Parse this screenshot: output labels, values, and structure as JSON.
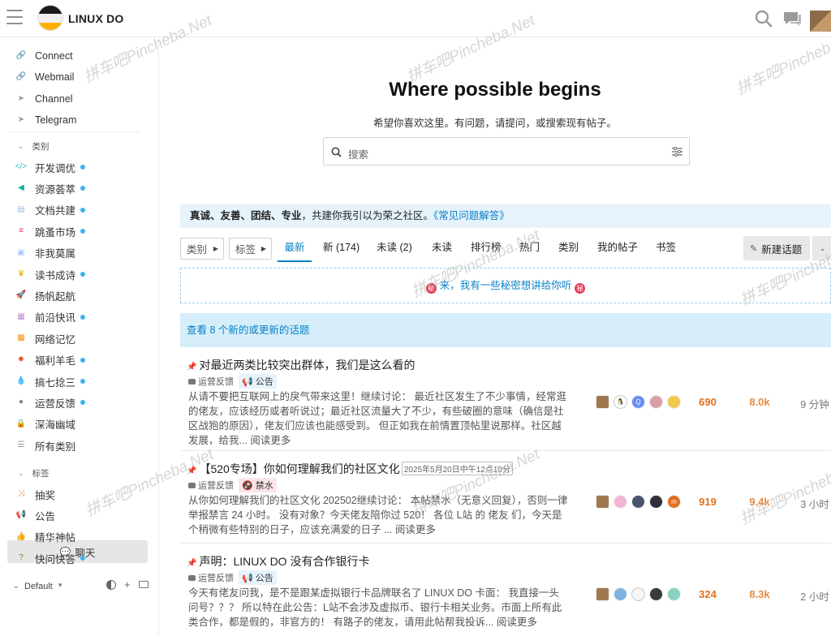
{
  "header": {
    "site_title": "LINUX DO"
  },
  "sidebar": {
    "links": [
      {
        "label": "Connect",
        "icon": "link-icon"
      },
      {
        "label": "Webmail",
        "icon": "link-icon"
      },
      {
        "label": "Channel",
        "icon": "send-icon"
      },
      {
        "label": "Telegram",
        "icon": "send-icon"
      }
    ],
    "categories_header": "类别",
    "categories": [
      {
        "label": "开发调优",
        "icon": "code-icon",
        "color": "#32c3c3",
        "dot": true
      },
      {
        "label": "资源荟萃",
        "icon": "share-icon",
        "color": "#12a89d",
        "dot": true
      },
      {
        "label": "文档共建",
        "icon": "doc-icon",
        "color": "#9cc2e6",
        "dot": true
      },
      {
        "label": "跳蚤市场",
        "icon": "stack-icon",
        "color": "#ed207b",
        "dot": true
      },
      {
        "label": "非我莫属",
        "icon": "briefcase-icon",
        "color": "#a8c6fe",
        "dot": false
      },
      {
        "label": "读书成诗",
        "icon": "crown-icon",
        "color": "#e0b100",
        "dot": true
      },
      {
        "label": "扬帆起航",
        "icon": "rocket-icon",
        "color": "#ff9838",
        "dot": false
      },
      {
        "label": "前沿快讯",
        "icon": "news-icon",
        "color": "#bb8fce",
        "dot": true
      },
      {
        "label": "网络记忆",
        "icon": "memory-icon",
        "color": "#f7941d",
        "dot": false
      },
      {
        "label": "福利羊毛",
        "icon": "gift-icon",
        "color": "#e45735",
        "dot": true
      },
      {
        "label": "搞七捻三",
        "icon": "drop-icon",
        "color": "#3ab54a",
        "dot": true
      },
      {
        "label": "运营反馈",
        "icon": "chat-icon",
        "color": "#808281",
        "dot": true
      },
      {
        "label": "深海幽域",
        "icon": "lock-icon",
        "color": "#45b7d1",
        "dot": false
      },
      {
        "label": "所有类别",
        "icon": "list-icon",
        "color": "#999999",
        "dot": false
      }
    ],
    "tags_header": "标签",
    "tags": [
      {
        "label": "抽奖",
        "icon": "shuffle-icon",
        "color": "#f07d22",
        "dot": false
      },
      {
        "label": "公告",
        "icon": "megaphone-icon",
        "color": "#1e88e5",
        "dot": false
      },
      {
        "label": "精华神帖",
        "icon": "thumbs-up-icon",
        "color": "#1e88e5",
        "dot": false
      },
      {
        "label": "快问快答",
        "icon": "question-icon",
        "color": "#5b8c2a",
        "dot": true
      }
    ],
    "chat_button": "聊天",
    "footer_theme": "Default"
  },
  "hero": {
    "title": "Where possible begins",
    "subtitle": "希望你喜欢这里。有问题，请提问，或搜索现有帖子。",
    "search_placeholder": "搜索"
  },
  "banner": {
    "values": "真诚、友善、团结、专业",
    "rest": "，共建你我引以为荣之社区。",
    "link": "《常见问题解答》"
  },
  "nav": {
    "category_dropdown": "类别",
    "tag_dropdown": "标签",
    "tabs": [
      "最新",
      "新 (174)",
      "未读 (2)",
      "未读",
      "排行榜",
      "热门",
      "类别",
      "我的帖子",
      "书签"
    ],
    "new_topic": "新建话题"
  },
  "hint": "来，我有一些秘密想讲给你听",
  "new_topics_notice": "查看 8 个新的或更新的话题",
  "topics": [
    {
      "title": "对最近两类比较突出群体，我们是这么看的",
      "date": "",
      "category": "运营反馈",
      "tag": "公告",
      "tag_icon": "megaphone-icon",
      "excerpt": "从请不要把互联网上的戾气带来这里！继续讨论：  最近社区发生了不少事情，经常逛的佬友，应该经历或者听说过；最近社区流量大了不少，有些破圈的意味（确信是社区战狍的原因），佬友们应该也能感受到。 但正如我在前情置顶帖里说那样。社区越发展，给我...",
      "read_more": "阅读更多",
      "replies": "690",
      "views": "8.0k",
      "activity": "9 分钟"
    },
    {
      "title": "【520专场】你如何理解我们的社区文化",
      "date": "2025年5月20日中午12点10分",
      "category": "运营反馈",
      "tag": "禁水",
      "tag_icon": "no-water-icon",
      "excerpt": "从你如何理解我们的社区文化 202502继续讨论：  本帖禁水（无意义回复），否则一律举报禁言 24 小时。 没有对象？今天佬友陪你过 520！ 各位 L站 的 佬友 们，今天是个稍微有些特别的日子，应该充满爱的日子 ...",
      "read_more": "阅读更多",
      "replies": "919",
      "views": "9.4k",
      "activity": "3 小时"
    },
    {
      "title": "声明：LINUX DO 没有合作银行卡",
      "date": "",
      "category": "运营反馈",
      "tag": "公告",
      "tag_icon": "megaphone-icon",
      "excerpt": "今天有佬友问我，是不是跟某虚拟银行卡品牌联名了 LINUX DO 卡面：  我直接一头问号？？？ 所以特在此公告：L站不会涉及虚拟币、银行卡相关业务。市面上所有此类合作，都是假的，非官方的！ 有路子的佬友，请用此帖帮我投诉...",
      "read_more": "阅读更多",
      "replies": "324",
      "views": "8.3k",
      "activity": "2 小时"
    }
  ],
  "watermark": "拼车吧Pincheba.Net"
}
